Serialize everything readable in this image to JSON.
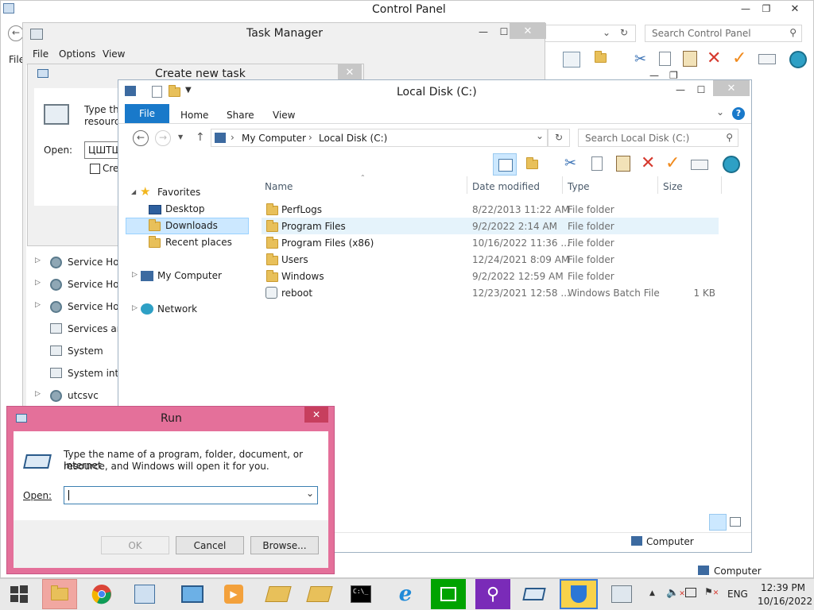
{
  "control_panel": {
    "title": "Control Panel",
    "search_placeholder": "Search Control Panel",
    "menu_fragment": "File"
  },
  "task_manager": {
    "title": "Task Manager",
    "menu": [
      "File",
      "Options",
      "View"
    ],
    "processes": [
      {
        "name": "Service Host",
        "icon": "gear-icon"
      },
      {
        "name": "Service Host",
        "icon": "gear-icon"
      },
      {
        "name": "Service Host",
        "icon": "gear-icon"
      },
      {
        "name": "Services and",
        "icon": "window-icon"
      },
      {
        "name": "System",
        "icon": "window-icon"
      },
      {
        "name": "System inter",
        "icon": "window-icon"
      },
      {
        "name": "utcsvc",
        "icon": "gear-icon"
      }
    ]
  },
  "create_task": {
    "title": "Create new task",
    "desc_line1": "Type the",
    "desc_line2": "resource",
    "open_label": "Open:",
    "open_value": "ЦШТШ",
    "checkbox_label": "Crea"
  },
  "explorer": {
    "title": "Local Disk (C:)",
    "ribbon_tabs": [
      "File",
      "Home",
      "Share",
      "View"
    ],
    "breadcrumb": [
      "My Computer",
      "Local Disk (C:)"
    ],
    "search_placeholder": "Search Local Disk (C:)",
    "nav": {
      "favorites": "Favorites",
      "desktop": "Desktop",
      "downloads": "Downloads",
      "recent": "Recent places",
      "my_computer": "My Computer",
      "network": "Network"
    },
    "columns": [
      "Name",
      "Date modified",
      "Type",
      "Size"
    ],
    "files": [
      {
        "name": "PerfLogs",
        "date": "8/22/2013 11:22 AM",
        "type": "File folder",
        "size": "",
        "icon": "folder-icon"
      },
      {
        "name": "Program Files",
        "date": "9/2/2022 2:14 AM",
        "type": "File folder",
        "size": "",
        "icon": "folder-icon"
      },
      {
        "name": "Program Files (x86)",
        "date": "10/16/2022 11:36 ...",
        "type": "File folder",
        "size": "",
        "icon": "folder-icon"
      },
      {
        "name": "Users",
        "date": "12/24/2021 8:09 AM",
        "type": "File folder",
        "size": "",
        "icon": "folder-icon"
      },
      {
        "name": "Windows",
        "date": "9/2/2022 12:59 AM",
        "type": "File folder",
        "size": "",
        "icon": "folder-icon"
      },
      {
        "name": "reboot",
        "date": "12/23/2021 12:58 ...",
        "type": "Windows Batch File",
        "size": "1 KB",
        "icon": "batch-file-icon"
      }
    ],
    "status_computer": "Computer"
  },
  "run_dialog": {
    "title": "Run",
    "desc_line1": "Type the name of a program, folder, document, or Internet",
    "desc_line2": "resource, and Windows will open it for you.",
    "open_label": "Open:",
    "input_value": "",
    "ok": "OK",
    "cancel": "Cancel",
    "browse": "Browse..."
  },
  "cp_status": "Computer",
  "taskbar": {
    "lang": "ENG",
    "time": "12:39 PM",
    "date": "10/16/2022"
  },
  "colors": {
    "run_border": "#e4709a",
    "file_tab": "#1979ca",
    "selection": "#cce8ff",
    "taskbar": "#e9e9e9"
  }
}
